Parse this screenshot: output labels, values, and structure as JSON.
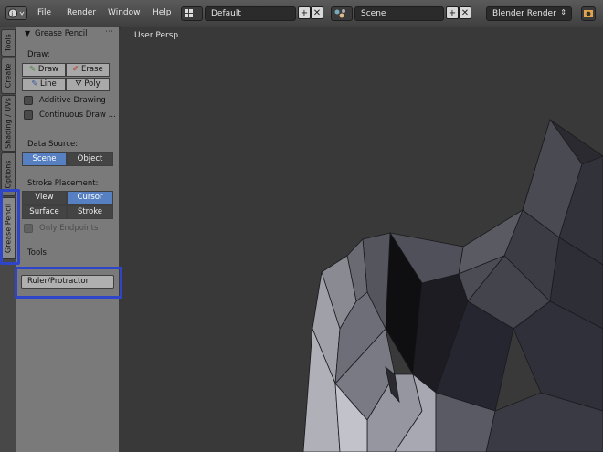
{
  "topbar": {
    "menus": [
      "File",
      "Render",
      "Window",
      "Help"
    ],
    "layout_field": "Default",
    "scene_field": "Scene",
    "engine_field": "Blender Render"
  },
  "tabs": [
    "Tools",
    "Create",
    "Shading / UVs",
    "Options",
    "Grease Pencil"
  ],
  "panel": {
    "title": "Grease Pencil",
    "draw_label": "Draw:",
    "draw_btn": "Draw",
    "erase_btn": "Erase",
    "line_btn": "Line",
    "poly_btn": "Poly",
    "additive": "Additive Drawing",
    "continuous": "Continuous Draw ...",
    "data_source_label": "Data Source:",
    "scene_btn": "Scene",
    "object_btn": "Object",
    "stroke_placement_label": "Stroke Placement:",
    "view_btn": "View",
    "cursor_btn": "Cursor",
    "surface_btn": "Surface",
    "stroke_btn": "Stroke",
    "only_endpoints": "Only Endpoints",
    "tools_label": "Tools:",
    "ruler_btn": "Ruler/Protractor"
  },
  "viewport": {
    "label": "User Persp"
  },
  "colors": {
    "selected": "#5680c2",
    "highlight": "#2e44c9"
  }
}
